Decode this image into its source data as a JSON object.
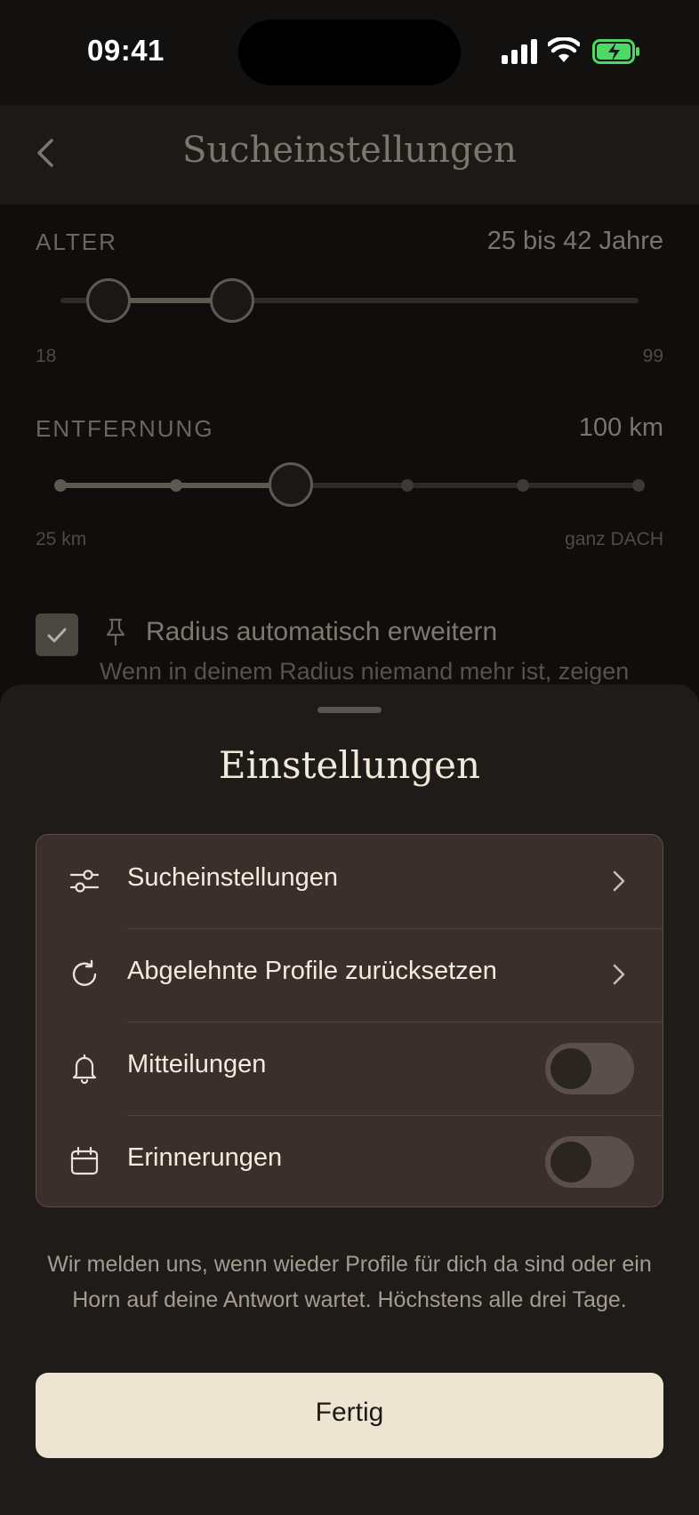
{
  "status_bar": {
    "time": "09:41"
  },
  "header": {
    "title": "Sucheinstellungen"
  },
  "age": {
    "label": "ALTER",
    "value": "25 bis 42 Jahre",
    "min_label": "18",
    "max_label": "99"
  },
  "distance": {
    "label": "ENTFERNUNG",
    "value": "100 km",
    "min_label": "25 km",
    "max_label": "ganz DACH"
  },
  "radius_option": {
    "title": "Radius automatisch erweitern",
    "description": "Wenn in deinem Radius niemand mehr ist, zeigen",
    "checked": true
  },
  "sheet": {
    "title": "Einstellungen",
    "items": [
      {
        "label": "Sucheinstellungen",
        "icon": "sliders-icon",
        "control": "chevron"
      },
      {
        "label": "Abgelehnte Profile zurücksetzen",
        "icon": "refresh-icon",
        "control": "chevron"
      },
      {
        "label": "Mitteilungen",
        "icon": "bell-icon",
        "control": "toggle",
        "on": false
      },
      {
        "label": "Erinnerungen",
        "icon": "calendar-icon",
        "control": "toggle",
        "on": false
      }
    ],
    "info_text": "Wir melden uns, wenn wieder Profile für dich da sind oder ein Horn auf deine Antwort wartet. Höchstens alle drei Tage.",
    "done_label": "Fertig"
  }
}
